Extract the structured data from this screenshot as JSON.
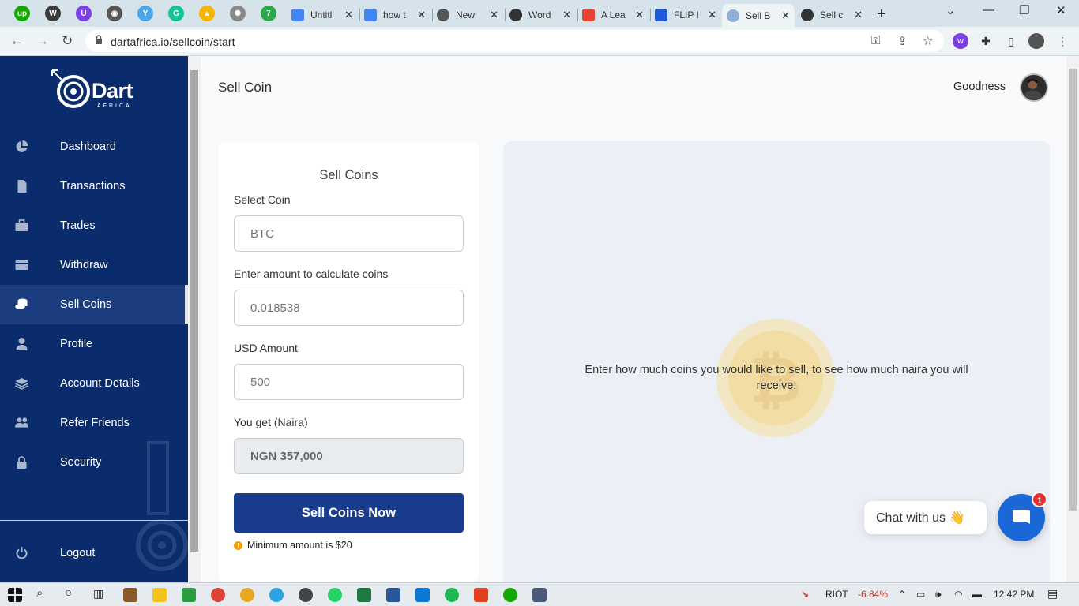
{
  "browser": {
    "tabs": [
      {
        "title": "Untitl",
        "icon": "google-docs-icon"
      },
      {
        "title": "how t",
        "icon": "google-docs-icon"
      },
      {
        "title": "New",
        "icon": "chrome-icon"
      },
      {
        "title": "Word",
        "icon": "globe-icon"
      },
      {
        "title": "A Lea",
        "icon": "gmail-icon"
      },
      {
        "title": "FLIP I",
        "icon": "flip-icon"
      },
      {
        "title": "Sell B",
        "icon": "dart-icon",
        "active": true
      },
      {
        "title": "Sell c",
        "icon": "globe-icon"
      }
    ],
    "url": "dartafrica.io/sellcoin/start"
  },
  "sidebar": {
    "logo_text": "Dart",
    "logo_sub": "AFRICA",
    "items": [
      {
        "label": "Dashboard",
        "icon": "pie-chart-icon"
      },
      {
        "label": "Transactions",
        "icon": "file-icon"
      },
      {
        "label": "Trades",
        "icon": "briefcase-icon"
      },
      {
        "label": "Withdraw",
        "icon": "credit-card-icon"
      },
      {
        "label": "Sell Coins",
        "icon": "coins-icon",
        "active": true
      },
      {
        "label": "Profile",
        "icon": "user-icon"
      },
      {
        "label": "Account Details",
        "icon": "layers-icon"
      },
      {
        "label": "Refer Friends",
        "icon": "users-icon"
      },
      {
        "label": "Security",
        "icon": "lock-icon"
      }
    ],
    "logout": "Logout"
  },
  "header": {
    "title": "Sell Coin",
    "username": "Goodness"
  },
  "form": {
    "title": "Sell Coins",
    "coin_label": "Select Coin",
    "coin_placeholder": "BTC",
    "amount_label": "Enter amount to calculate coins",
    "amount_value": "0.018538",
    "usd_label": "USD Amount",
    "usd_value": "500",
    "naira_label": "You get (Naira)",
    "naira_value": "NGN 357,000",
    "submit": "Sell Coins Now",
    "note": "Minimum amount is $20"
  },
  "panel": {
    "hint": "Enter how much coins you would like to sell, to see how much naira you will receive."
  },
  "chat": {
    "label": "Chat with us 👋",
    "badge": "1"
  },
  "taskbar": {
    "stock": "RIOT",
    "change": "-6.84%",
    "time": "12:42 PM"
  },
  "colors": {
    "sidebar": "#0b2c6c",
    "accent": "#1a3c8c",
    "chat": "#1a67d8",
    "warning": "#f39c12"
  }
}
